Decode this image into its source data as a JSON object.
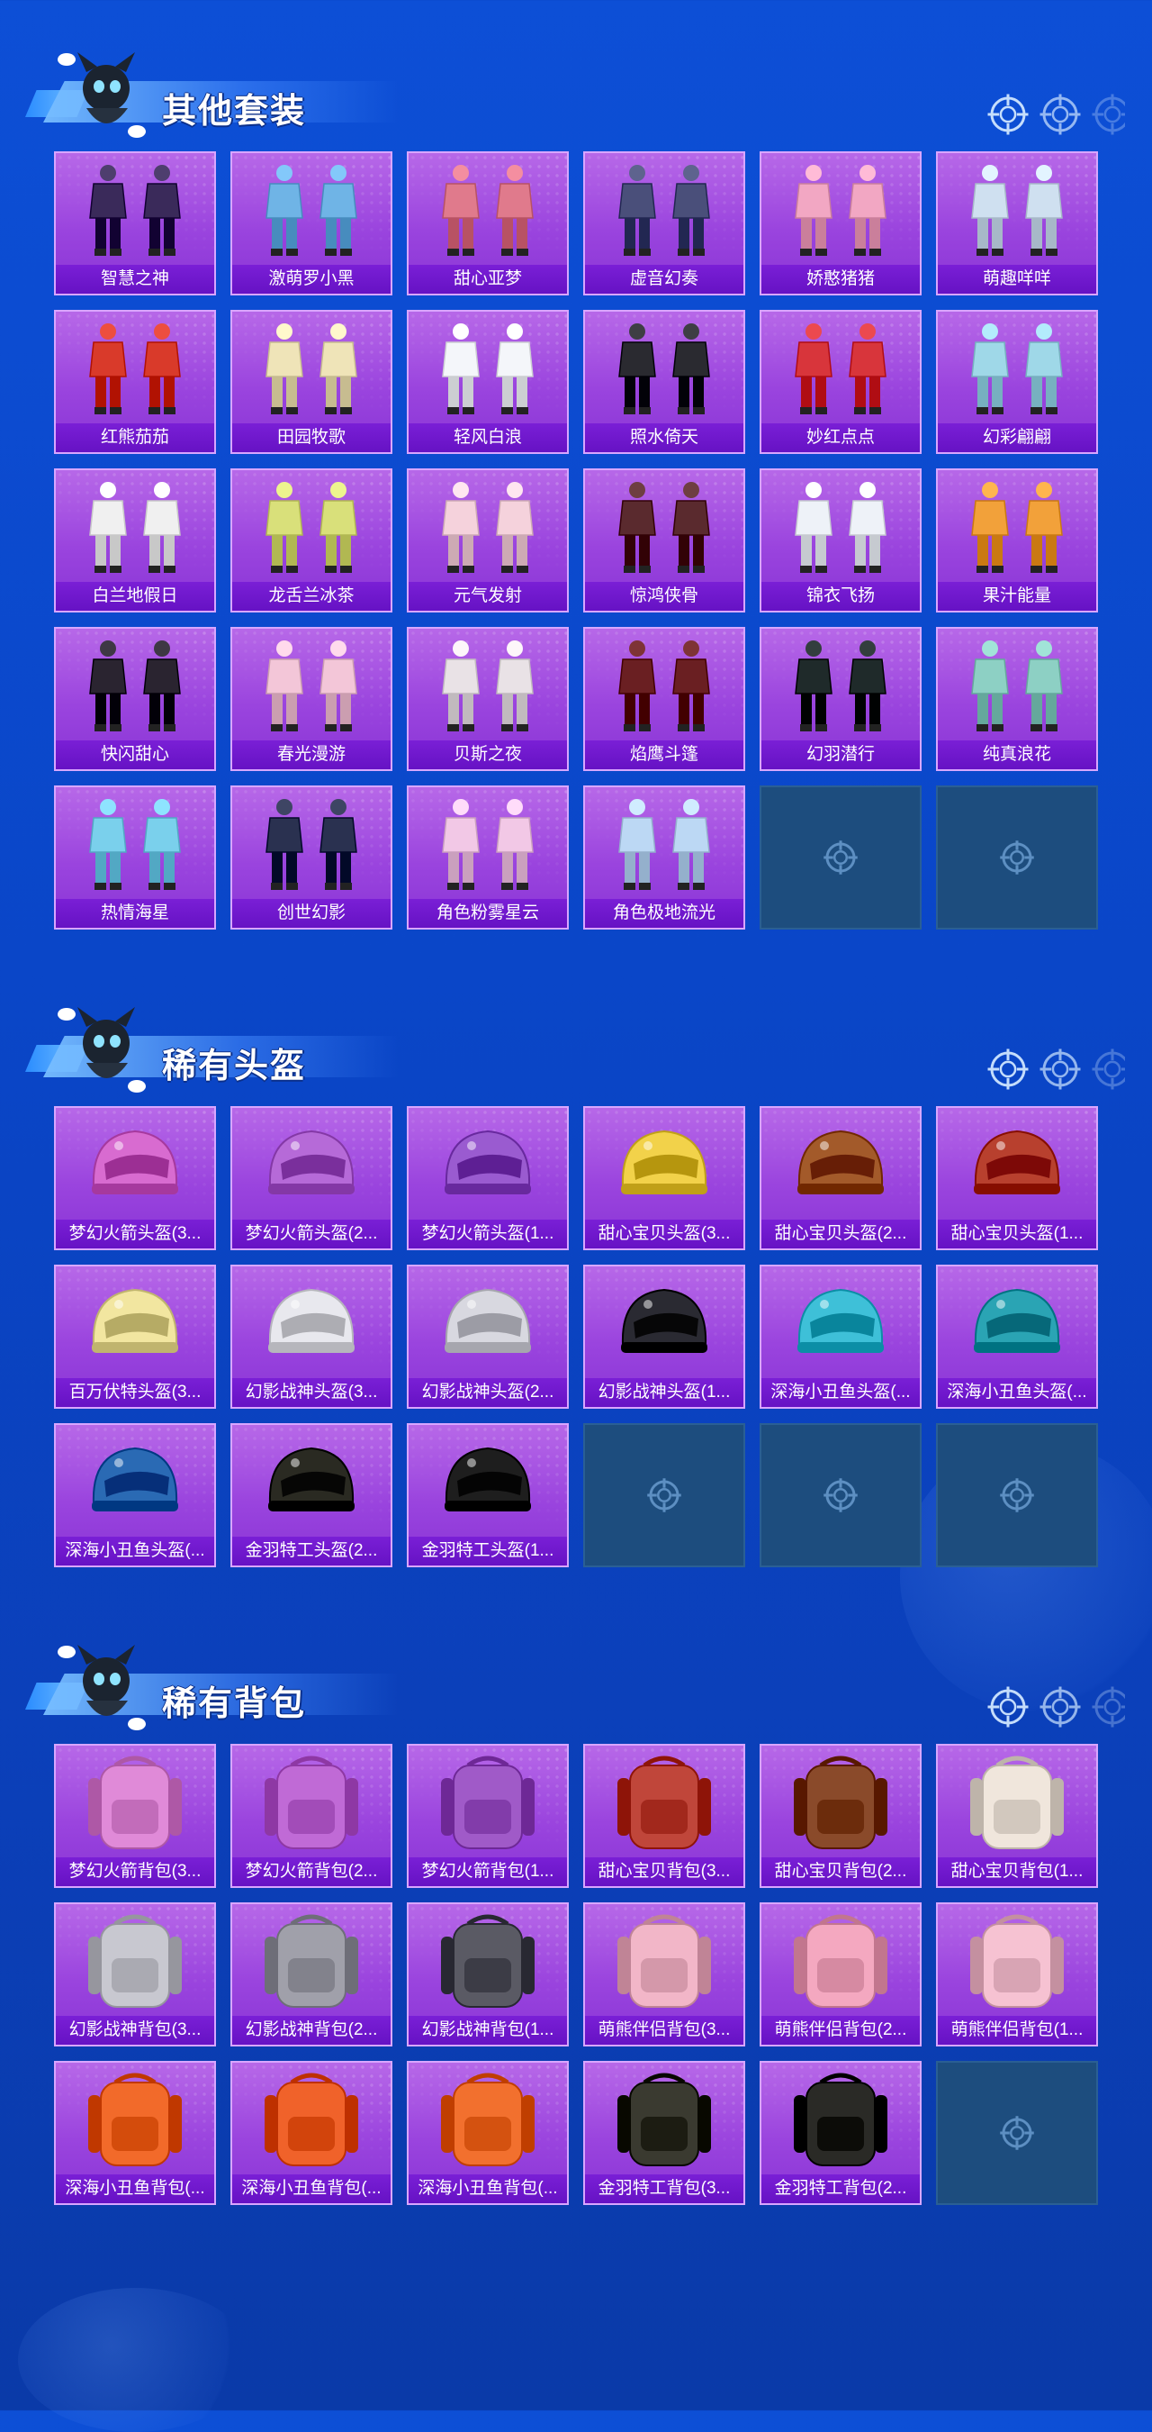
{
  "sections": [
    {
      "title": "其他套装",
      "kind": "outfit",
      "items": [
        {
          "label": "智慧之神",
          "color": "#3a2a5a"
        },
        {
          "label": "激萌罗小黑",
          "color": "#6fb4e6"
        },
        {
          "label": "甜心亚梦",
          "color": "#e07a8c"
        },
        {
          "label": "虚音幻奏",
          "color": "#4a4f7a"
        },
        {
          "label": "娇憨猪猪",
          "color": "#f2a7c3"
        },
        {
          "label": "萌趣咩咩",
          "color": "#cfe0f0"
        },
        {
          "label": "红熊茄茄",
          "color": "#d93a2a"
        },
        {
          "label": "田园牧歌",
          "color": "#efe4b8"
        },
        {
          "label": "轻风白浪",
          "color": "#f4f6fa"
        },
        {
          "label": "照水倚天",
          "color": "#2a2a30"
        },
        {
          "label": "妙红点点",
          "color": "#d8353b"
        },
        {
          "label": "幻彩翩翩",
          "color": "#9fd8e8"
        },
        {
          "label": "白兰地假日",
          "color": "#f0f0f0"
        },
        {
          "label": "龙舌兰冰茶",
          "color": "#d9e07a"
        },
        {
          "label": "元气发射",
          "color": "#f5d2dc"
        },
        {
          "label": "惊鸿侠骨",
          "color": "#5a2a2e"
        },
        {
          "label": "锦衣飞扬",
          "color": "#eef2f8"
        },
        {
          "label": "果汁能量",
          "color": "#f2a13a"
        },
        {
          "label": "快闪甜心",
          "color": "#2a2430"
        },
        {
          "label": "春光漫游",
          "color": "#f3c6d8"
        },
        {
          "label": "贝斯之夜",
          "color": "#e9e2e6"
        },
        {
          "label": "焰鹰斗篷",
          "color": "#6a1f22"
        },
        {
          "label": "幻羽潜行",
          "color": "#1f2a2a"
        },
        {
          "label": "纯真浪花",
          "color": "#8dd0c4"
        },
        {
          "label": "热情海星",
          "color": "#7ad0ec"
        },
        {
          "label": "创世幻影",
          "color": "#2a3150"
        },
        {
          "label": "角色粉雾星云",
          "color": "#f2c8e6"
        },
        {
          "label": "角色极地流光",
          "color": "#bcd8f4"
        },
        {
          "label": "",
          "empty": true
        },
        {
          "label": "",
          "empty": true
        }
      ]
    },
    {
      "title": "稀有头盔",
      "kind": "helmet",
      "items": [
        {
          "label": "梦幻火箭头盔(3...",
          "color": "#d86bd0"
        },
        {
          "label": "梦幻火箭头盔(2...",
          "color": "#b66ad8"
        },
        {
          "label": "梦幻火箭头盔(1...",
          "color": "#9a5bd0"
        },
        {
          "label": "甜心宝贝头盔(3...",
          "color": "#f2d24a"
        },
        {
          "label": "甜心宝贝头盔(2...",
          "color": "#a35a2a"
        },
        {
          "label": "甜心宝贝头盔(1...",
          "color": "#b8402e"
        },
        {
          "label": "百万伏特头盔(3...",
          "color": "#f2e6a0"
        },
        {
          "label": "幻影战神头盔(3...",
          "color": "#e8e8ee"
        },
        {
          "label": "幻影战神头盔(2...",
          "color": "#d8d8e0"
        },
        {
          "label": "幻影战神头盔(1...",
          "color": "#2a2a32"
        },
        {
          "label": "深海小丑鱼头盔(...",
          "color": "#3ec0d8"
        },
        {
          "label": "深海小丑鱼头盔(...",
          "color": "#2aa4b4"
        },
        {
          "label": "深海小丑鱼头盔(...",
          "color": "#2a6ab4"
        },
        {
          "label": "金羽特工头盔(2...",
          "color": "#2a2a22"
        },
        {
          "label": "金羽特工头盔(1...",
          "color": "#1e1e1e"
        },
        {
          "label": "",
          "empty": true
        },
        {
          "label": "",
          "empty": true
        },
        {
          "label": "",
          "empty": true
        }
      ]
    },
    {
      "title": "稀有背包",
      "kind": "backpack",
      "items": [
        {
          "label": "梦幻火箭背包(3...",
          "color": "#e08ad8"
        },
        {
          "label": "梦幻火箭背包(2...",
          "color": "#c06ad6"
        },
        {
          "label": "梦幻火箭背包(1...",
          "color": "#a05ac8"
        },
        {
          "label": "甜心宝贝背包(3...",
          "color": "#c0463a"
        },
        {
          "label": "甜心宝贝背包(2...",
          "color": "#8a4a2a"
        },
        {
          "label": "甜心宝贝背包(1...",
          "color": "#f0e6dc"
        },
        {
          "label": "幻影战神背包(3...",
          "color": "#c8c8d0"
        },
        {
          "label": "幻影战神背包(2...",
          "color": "#a0a0aa"
        },
        {
          "label": "幻影战神背包(1...",
          "color": "#5a5a64"
        },
        {
          "label": "萌熊伴侣背包(3...",
          "color": "#f2b6c8"
        },
        {
          "label": "萌熊伴侣背包(2...",
          "color": "#f4a8c0"
        },
        {
          "label": "萌熊伴侣背包(1...",
          "color": "#f6c2d2"
        },
        {
          "label": "深海小丑鱼背包(...",
          "color": "#f26a2a"
        },
        {
          "label": "深海小丑鱼背包(...",
          "color": "#f0622a"
        },
        {
          "label": "深海小丑鱼背包(...",
          "color": "#f2702e"
        },
        {
          "label": "金羽特工背包(3...",
          "color": "#3a3a30"
        },
        {
          "label": "金羽特工背包(2...",
          "color": "#2a2a26"
        },
        {
          "label": "",
          "empty": true
        }
      ]
    }
  ]
}
